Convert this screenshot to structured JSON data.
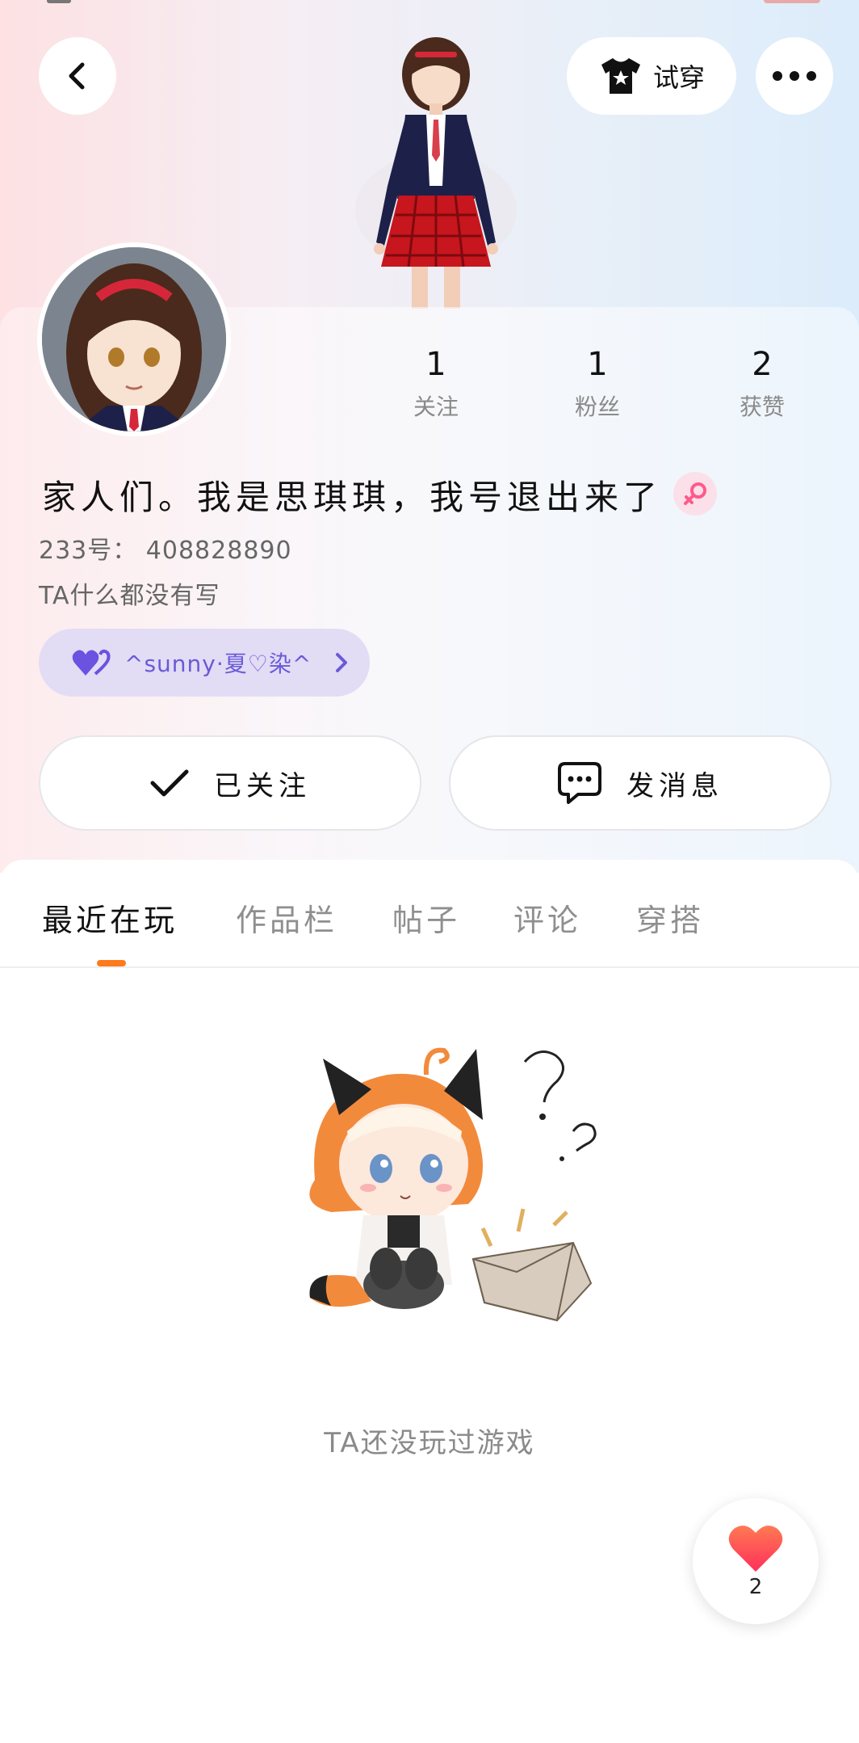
{
  "header": {
    "tryon_label": "试穿"
  },
  "stats": [
    {
      "value": "1",
      "label": "关注"
    },
    {
      "value": "1",
      "label": "粉丝"
    },
    {
      "value": "2",
      "label": "获赞"
    }
  ],
  "profile": {
    "nickname": "家人们。我是思琪琪，我号退出来了",
    "uid": "233号： 408828890",
    "bio": "TA什么都没有写",
    "group_name": "^sunny·夏♡染^"
  },
  "actions": {
    "follow_label": "已关注",
    "message_label": "发消息"
  },
  "tabs": [
    {
      "label": "最近在玩",
      "active": true
    },
    {
      "label": "作品栏",
      "active": false
    },
    {
      "label": "帖子",
      "active": false
    },
    {
      "label": "评论",
      "active": false
    },
    {
      "label": "穿搭",
      "active": false
    }
  ],
  "empty_state": {
    "text": "TA还没玩过游戏"
  },
  "like_button": {
    "count": "2"
  },
  "colors": {
    "accent": "#ff7a1a",
    "group_bg": "#e2dcf5",
    "group_text": "#6a5ad8",
    "heart": "#ff4a5e"
  },
  "icons": [
    "back-arrow-icon",
    "tshirt-icon",
    "more-dots-icon",
    "female-icon",
    "hearts-icon",
    "chevron-right-icon",
    "check-icon",
    "chat-bubble-icon",
    "heart-icon"
  ]
}
